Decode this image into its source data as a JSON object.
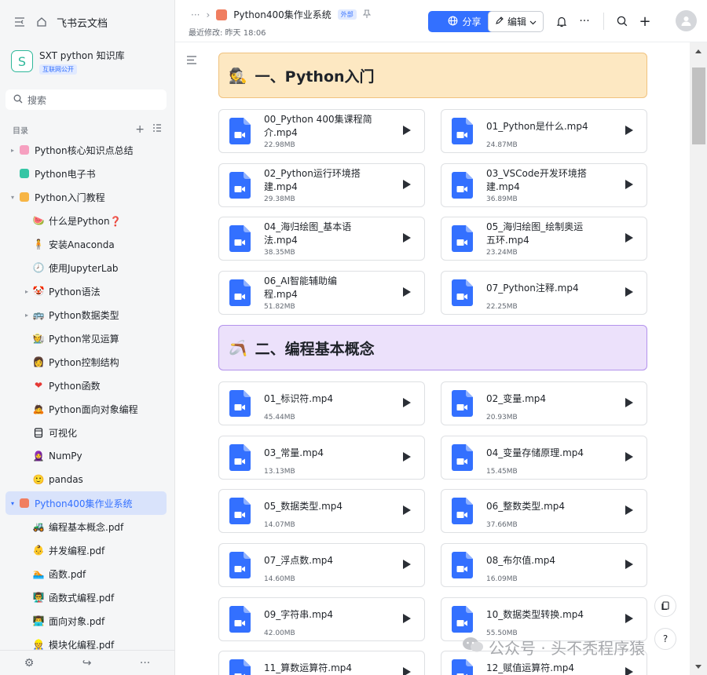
{
  "sidebar": {
    "brand": "飞书云文档",
    "wiki_logo": "S",
    "wiki_name": "SXT python 知识库",
    "wiki_badge": "互联网公开",
    "search_label": "搜索",
    "toc_label": "目录",
    "items": [
      {
        "label": "Python核心知识点总结"
      },
      {
        "label": "Python电子书"
      },
      {
        "label": "Python入门教程"
      },
      {
        "label": "什么是Python❓"
      },
      {
        "label": "安装Anaconda"
      },
      {
        "label": "使用JupyterLab"
      },
      {
        "label": "Python语法"
      },
      {
        "label": "Python数据类型"
      },
      {
        "label": "Python常见运算"
      },
      {
        "label": "Python控制结构"
      },
      {
        "label": "Python函数"
      },
      {
        "label": "Python面向对象编程"
      },
      {
        "label": "可视化"
      },
      {
        "label": "NumPy"
      },
      {
        "label": "pandas"
      },
      {
        "label": "Python400集作业系统"
      },
      {
        "label": "编程基本概念.pdf"
      },
      {
        "label": "并发编程.pdf"
      },
      {
        "label": "函数.pdf"
      },
      {
        "label": "函数式编程.pdf"
      },
      {
        "label": "面向对象.pdf"
      },
      {
        "label": "模块化编程.pdf"
      }
    ]
  },
  "header": {
    "breadcrumb_dots": "···",
    "title": "Python400集作业系统",
    "badge": "外部",
    "last_modified": "最近修改: 昨天 18:06",
    "share_label": "分享",
    "edit_label": "编辑"
  },
  "sections": [
    {
      "emoji": "🕵",
      "title": "一、Python入门"
    },
    {
      "emoji": "🪃",
      "title": "二、编程基本概念"
    }
  ],
  "files_a": [
    {
      "name": "00_Python 400集课程简介.mp4",
      "line1": "00_Python 400集课程简",
      "line2": "介.mp4",
      "size": "22.98MB"
    },
    {
      "name": "01_Python是什么.mp4",
      "line1": "01_Python是什么.mp4",
      "line2": "",
      "size": "24.87MB"
    },
    {
      "name": "02_Python运行环境搭建.mp4",
      "line1": "02_Python运行环境搭",
      "line2": "建.mp4",
      "size": "29.38MB"
    },
    {
      "name": "03_VSCode开发环境搭建.mp4",
      "line1": "03_VSCode开发环境搭",
      "line2": "建.mp4",
      "size": "36.89MB"
    },
    {
      "name": "04_海归绘图_基本语法.mp4",
      "line1": "04_海归绘图_基本语",
      "line2": "法.mp4",
      "size": "38.35MB"
    },
    {
      "name": "05_海归绘图_绘制奥运五环.mp4",
      "line1": "05_海归绘图_绘制奥运",
      "line2": "五环.mp4",
      "size": "23.24MB"
    },
    {
      "name": "06_AI智能辅助编程.mp4",
      "line1": "06_AI智能辅助编",
      "line2": "程.mp4",
      "size": "51.82MB"
    },
    {
      "name": "07_Python注释.mp4",
      "line1": "07_Python注释.mp4",
      "line2": "",
      "size": "22.25MB"
    }
  ],
  "files_b": [
    {
      "name": "01_标识符.mp4",
      "size": "45.44MB"
    },
    {
      "name": "02_变量.mp4",
      "size": "20.93MB"
    },
    {
      "name": "03_常量.mp4",
      "size": "13.13MB"
    },
    {
      "name": "04_变量存储原理.mp4",
      "size": "15.45MB"
    },
    {
      "name": "05_数据类型.mp4",
      "size": "14.07MB"
    },
    {
      "name": "06_整数类型.mp4",
      "size": "37.66MB"
    },
    {
      "name": "07_浮点数.mp4",
      "size": "14.60MB"
    },
    {
      "name": "08_布尔值.mp4",
      "size": "16.09MB"
    },
    {
      "name": "09_字符串.mp4",
      "size": "42.00MB"
    },
    {
      "name": "10_数据类型转换.mp4",
      "size": "55.50MB"
    },
    {
      "name": "11_算数运算符.mp4",
      "size": ""
    },
    {
      "name": "12_赋值运算符.mp4",
      "size": ""
    }
  ],
  "watermark": "公众号 · 头不秃程序猿",
  "colors": {
    "accent": "#3370ff",
    "video_icon": "#3370ff",
    "section_a_bg": "#fde8c2",
    "section_b_bg": "#ece1fb"
  }
}
